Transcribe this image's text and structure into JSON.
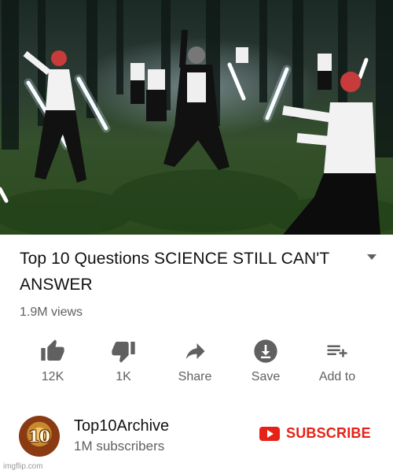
{
  "video": {
    "description_icon": "video-frame"
  },
  "info": {
    "title_line1": "Top 10 Questions SCIENCE STILL CAN'T",
    "title_line2": "ANSWER",
    "views": "1.9M views",
    "expand_icon": "triangle-down-icon"
  },
  "actions": [
    {
      "icon": "thumbs-up-icon",
      "label": "12K"
    },
    {
      "icon": "thumbs-down-icon",
      "label": "1K"
    },
    {
      "icon": "share-arrow-icon",
      "label": "Share"
    },
    {
      "icon": "download-icon",
      "label": "Save"
    },
    {
      "icon": "add-to-playlist-icon",
      "label": "Add to"
    }
  ],
  "channel": {
    "avatar_text": "10",
    "name": "Top10Archive",
    "subscribers": "1M subscribers",
    "subscribe_label": "SUBSCRIBE",
    "subscribe_color": "#e62117"
  },
  "watermark": "imgflip.com"
}
